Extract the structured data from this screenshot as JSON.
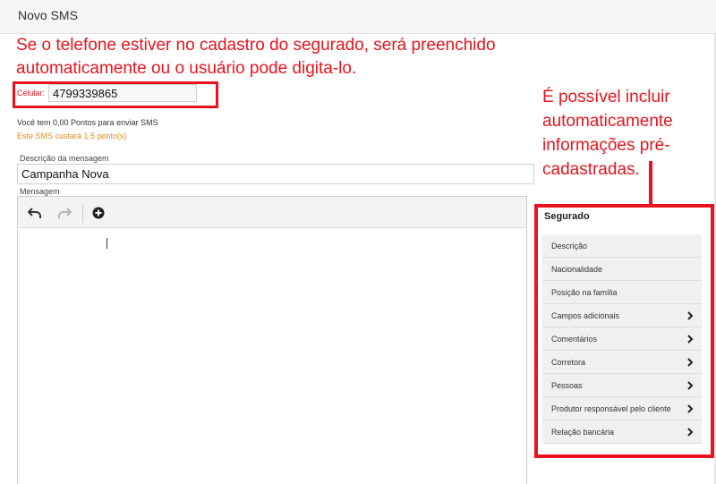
{
  "window": {
    "title": "Novo SMS"
  },
  "annotations": {
    "top": "Se o telefone estiver no cadastro do segurado, será preenchido automaticamente ou o usuário pode digita-lo.",
    "right": "É possível incluir automaticamente informações pré-cadastradas.",
    "color": "#e8141d"
  },
  "phone": {
    "label": "Celular:",
    "value": "4799339865"
  },
  "sms_info": {
    "points": "Você tem 0,00 Pontos para enviar SMS",
    "cost": "Este SMS custará 1.5 ponto(s)"
  },
  "description": {
    "label": "Descrição da mensagem",
    "value": "Campanha Nova"
  },
  "message": {
    "label": "Mensagem",
    "toolbar": {
      "undo": "undo-icon",
      "redo": "redo-icon",
      "insert": "plus-circle-icon"
    }
  },
  "sidebar": {
    "title": "Segurado",
    "items": [
      {
        "label": "Descrição",
        "has_submenu": false
      },
      {
        "label": "Nacionalidade",
        "has_submenu": false
      },
      {
        "label": "Posição na família",
        "has_submenu": false
      },
      {
        "label": "Campos adicionais",
        "has_submenu": true
      },
      {
        "label": "Comentários",
        "has_submenu": true
      },
      {
        "label": "Corretora",
        "has_submenu": true
      },
      {
        "label": "Pessoas",
        "has_submenu": true
      },
      {
        "label": "Produtor responsável pelo cliente",
        "has_submenu": true
      },
      {
        "label": "Relação bancária",
        "has_submenu": true
      }
    ]
  }
}
